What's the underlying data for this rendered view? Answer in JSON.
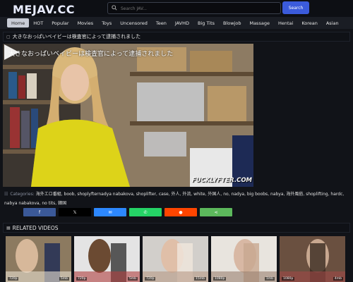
{
  "site": {
    "logo": "MEJAV.CC"
  },
  "search": {
    "placeholder": "Search JAV...",
    "button": "Search"
  },
  "nav": [
    "Home",
    "HOT",
    "Popular",
    "Movies",
    "Toys",
    "Uncensored",
    "Teen",
    "JAVHD",
    "Big Tits",
    "Blowjob",
    "Massage",
    "Hentai",
    "Korean",
    "Asian"
  ],
  "video": {
    "title": "大きなおっぱいベイビーは検査官によって逮捕されました",
    "overlay_title": "大きなおっぱいベイビーは検査官によって逮捕されました",
    "watermark": "FUCKLYFTER.COM"
  },
  "categories": {
    "label": "Categories:",
    "items": [
      "海外エロ番組",
      "boob",
      "shoplyfternadya nabakova",
      "shoplifter",
      "case",
      "外人",
      "外流",
      "white",
      "外国人",
      "no",
      "nadya",
      "big boobs",
      "nabya",
      "海外風俗",
      "shoplifting",
      "hardc",
      "nabya nabakova",
      "no tits",
      "韓国"
    ]
  },
  "share": [
    {
      "icon": "facebook-icon",
      "glyph": "f",
      "color": "#3b5998"
    },
    {
      "icon": "x-icon",
      "glyph": "𝕏",
      "color": "#000000"
    },
    {
      "icon": "messenger-icon",
      "glyph": "✉",
      "color": "#2d88ff"
    },
    {
      "icon": "whatsapp-icon",
      "glyph": "✆",
      "color": "#25d366"
    },
    {
      "icon": "reddit-icon",
      "glyph": "●",
      "color": "#ff4500"
    },
    {
      "icon": "sharethis-icon",
      "glyph": "⋖",
      "color": "#5cb85c"
    }
  ],
  "related": {
    "title": "RELATED VIDEOS",
    "thumbs": [
      {
        "quality": "720p",
        "views": "5mb"
      },
      {
        "quality": "720p",
        "views": "5mb"
      },
      {
        "quality": "720p",
        "views": "15mb"
      },
      {
        "quality": "1080p",
        "views": "1mb"
      },
      {
        "quality": "1080p",
        "views": "4mb"
      }
    ]
  }
}
